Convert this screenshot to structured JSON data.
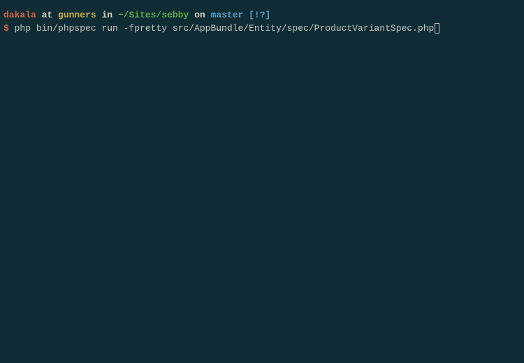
{
  "prompt": {
    "user": "dakala",
    "at": " at ",
    "host": "gunners",
    "in": " in ",
    "path": "~/Sites/sebby",
    "on": " on ",
    "branch": "master",
    "git_status": " [!?]"
  },
  "command_line": {
    "symbol": "$",
    "command": " php bin/phpspec run -fpretty src/AppBundle/Entity/spec/ProductVariantSpec.php"
  }
}
